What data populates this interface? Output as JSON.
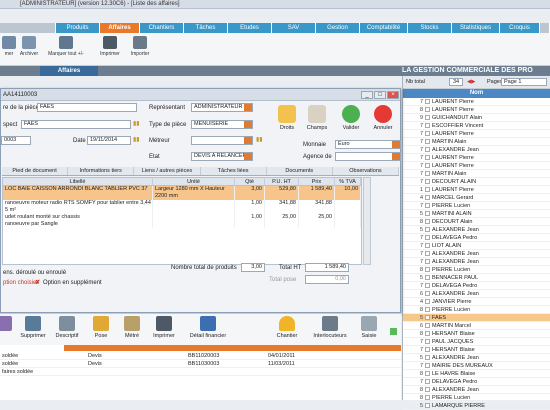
{
  "window": {
    "title": "[ADMINISTRATEUR] (version 12.30C6) - [Liste des affaires]"
  },
  "nav": {
    "tabs": [
      "Produits",
      "Affaires",
      "Chantiers",
      "Tâches",
      "Etudes",
      "SAV",
      "Gestion",
      "Comptabilité",
      "Stocks",
      "Statistiques",
      "Croquis"
    ],
    "active": "Affaires"
  },
  "toolbar": {
    "buttons": [
      "mer",
      "Archiver",
      "Marquer tout +/-",
      "Imprimer",
      "Importer"
    ]
  },
  "section": {
    "label": "Affaires"
  },
  "banner": "LA GESTION COMMERCIALE DES PRO",
  "right_panel": {
    "nb_total_label": "Nb total",
    "nb_total_value": "34",
    "pages_label": "Pages",
    "pages_value": "Page 1",
    "column": "Nom",
    "rows": [
      {
        "id": "7",
        "name": "LAURENT Pierre"
      },
      {
        "id": "8",
        "name": "LAURENT Pierre"
      },
      {
        "id": "9",
        "name": "GUICHANDUT Alain"
      },
      {
        "id": "7",
        "name": "ESCOFFIER Vincent"
      },
      {
        "id": "7",
        "name": "LAURENT Pierre"
      },
      {
        "id": "7",
        "name": "MARTIN Alain"
      },
      {
        "id": "7",
        "name": "ALEXANDRE Jean"
      },
      {
        "id": "7",
        "name": "LAURENT Pierre"
      },
      {
        "id": "7",
        "name": "LAURENT Pierre"
      },
      {
        "id": "7",
        "name": "MARTIN Alain"
      },
      {
        "id": "7",
        "name": "DECOURT ALAIN"
      },
      {
        "id": "1",
        "name": "LAURENT Pierre"
      },
      {
        "id": "4",
        "name": "MARCEL Gerard"
      },
      {
        "id": "7",
        "name": "PIERRE Lucien"
      },
      {
        "id": "5",
        "name": "MARTINI ALAIN"
      },
      {
        "id": "8",
        "name": "DECOURT Alain"
      },
      {
        "id": "5",
        "name": "ALEXANDRE Jean"
      },
      {
        "id": "7",
        "name": "DELAVEGA Pedro"
      },
      {
        "id": "7",
        "name": "LIOT ALAIN"
      },
      {
        "id": "7",
        "name": "ALEXANDRE Jean"
      },
      {
        "id": "7",
        "name": "ALEXANDRE Jean"
      },
      {
        "id": "8",
        "name": "PIERRE Lucien"
      },
      {
        "id": "5",
        "name": "BENNACER PAUL"
      },
      {
        "id": "7",
        "name": "DELAVEGA Pedro"
      },
      {
        "id": "6",
        "name": "ALEXANDRE Jean"
      },
      {
        "id": "4",
        "name": "JANVIER Pierre"
      },
      {
        "id": "8",
        "name": "PIERRE Lucien"
      },
      {
        "id": "5",
        "name": "FAES"
      },
      {
        "id": "6",
        "name": "MARTIN Marcel"
      },
      {
        "id": "8",
        "name": "HERSANT Blaise"
      },
      {
        "id": "7",
        "name": "PAUL JACQUES"
      },
      {
        "id": "7",
        "name": "HERSANT Blaise"
      },
      {
        "id": "5",
        "name": "ALEXANDRE Jean"
      },
      {
        "id": "7",
        "name": "MAIRIE DES MUREAUX"
      },
      {
        "id": "8",
        "name": "LE HAVRE Blaise"
      },
      {
        "id": "7",
        "name": "DELAVEGA Pedro"
      },
      {
        "id": "8",
        "name": "ALEXANDRE Jean"
      },
      {
        "id": "8",
        "name": "PIERRE Lucien"
      },
      {
        "id": "5",
        "name": "LAMARQUE PIERRE"
      }
    ]
  },
  "modal": {
    "title": "AA14110003",
    "fields": {
      "ref_label": "re de la pièce",
      "ref_value": "FAES",
      "rep_label": "Représentant",
      "rep_value": "ADMINISTRATEUR",
      "type_label": "Type de pièce",
      "type_value": "MENUISERIE",
      "prospect_label": "spect",
      "prospect_value": "FAES",
      "metreur_label": "Métreur",
      "metreur_value": "",
      "etat_label": "Etat",
      "etat_value": "DEVIS A RELANCER",
      "num_value": "0003",
      "date_label": "Date",
      "date_value": "19/11/2014",
      "monnaie_label": "Monnaie",
      "monnaie_value": "Euro",
      "agence_label": "Agence de",
      "agence_value": ""
    },
    "actions": [
      "Droits",
      "Champs",
      "Valider",
      "Annuler"
    ],
    "subtabs": [
      "Pied de document",
      "Informations tiers",
      "Liens / autres pièces",
      "Tâches liées",
      "Documents",
      "Observations"
    ],
    "grid": {
      "columns": [
        "Libellé",
        "Unité",
        "Qté",
        "P.U. HT",
        "Prix",
        "% TVA"
      ],
      "rows": [
        {
          "lib": "LOC BAIE CAISSON ARRONDI BLANC TABLIER PVC 37",
          "unit": "Largeur 1280 mm X Hauteur 2200  mm",
          "qty": "3,00",
          "pu": "529,80",
          "prix": "1 589,40",
          "tva": "10,00"
        },
        {
          "lib": "ranoeuvre moteur radio RTS SOMFY pour tablier entre 3,44 m²",
          "unit": "",
          "qty": "1,00",
          "pu": "341,88",
          "prix": "341,88",
          "tva": ""
        },
        {
          "lib": "5 m²",
          "unit": "",
          "qty": "",
          "pu": "",
          "prix": "",
          "tva": ""
        },
        {
          "lib": "udet roulant monté sur chassis",
          "unit": "",
          "qty": "1,00",
          "pu": "25,00",
          "prix": "25,00",
          "tva": ""
        },
        {
          "lib": "ranoeuvre par Sangle",
          "unit": "",
          "qty": "",
          "pu": "",
          "prix": "",
          "tva": ""
        }
      ]
    },
    "totals": {
      "nb_label": "Nombre total de produits",
      "nb_value": "3,00",
      "total_ht_label": "Total HT",
      "total_ht_value": "1 589,40",
      "total_pose_label": "Total pose",
      "total_pose_value": "0,00"
    },
    "legend": {
      "line1": "ens. déroulé ou enroulé",
      "line2": "ption choisie",
      "line3": "Option en supplément"
    }
  },
  "bottom_toolbar": {
    "buttons": [
      "Supprimer",
      "Descriptif",
      "Pose",
      "Métré",
      "Imprimer",
      "Détail financier",
      "Chantier",
      "Interlocuteurs",
      "Saisie"
    ]
  },
  "lower_list": {
    "rows": [
      {
        "c1": "soldée",
        "c2": "Devis",
        "c3": "BB11020003",
        "c4": "04/01/2011"
      },
      {
        "c1": "soldée",
        "c2": "Devis",
        "c3": "BB11030003",
        "c4": "11/03/2011"
      },
      {
        "c1": "faires soldée",
        "c2": "",
        "c3": "",
        "c4": ""
      }
    ]
  }
}
